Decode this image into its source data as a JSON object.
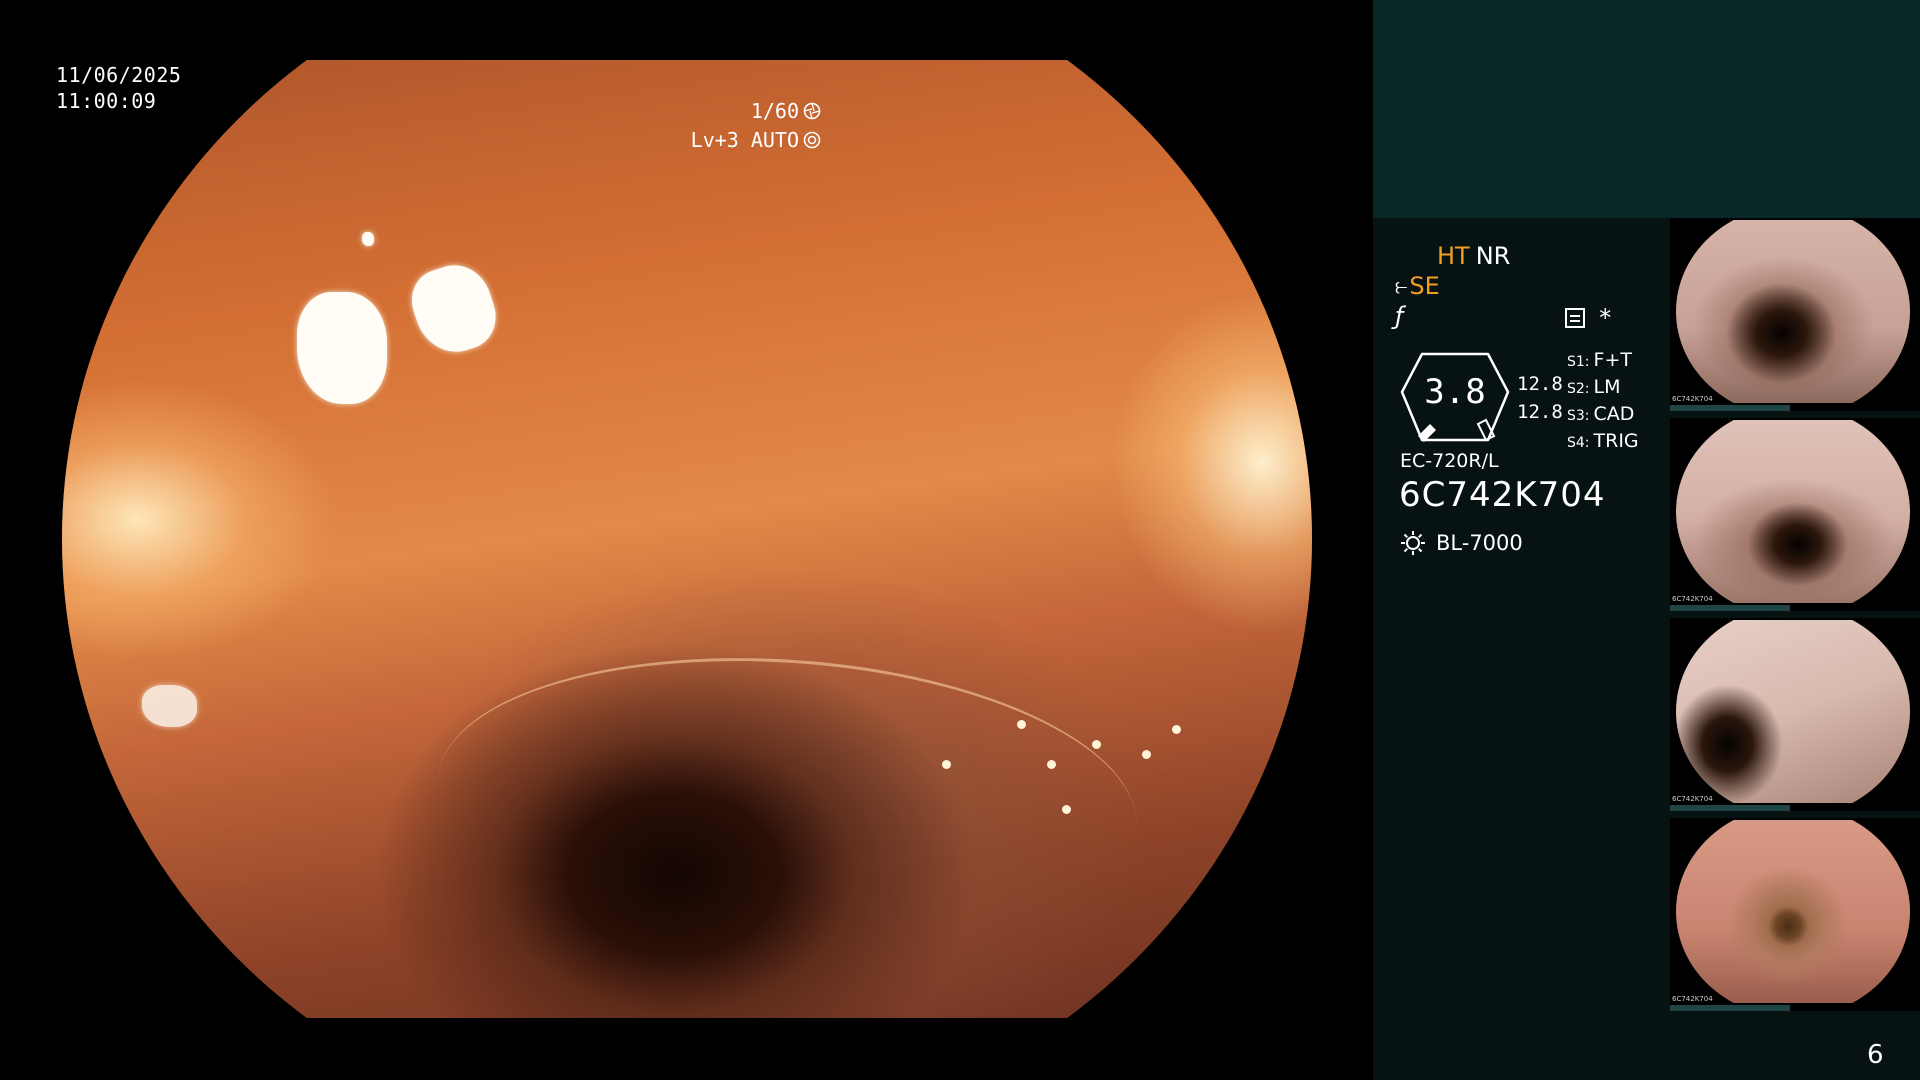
{
  "datetime": {
    "date": "11/06/2025",
    "time": "11:00:09"
  },
  "exposure": {
    "shutter": "1/60",
    "level": "Lv+3",
    "mode": "AUTO"
  },
  "status": {
    "ht": "HT",
    "nr": "NR",
    "se": "SE",
    "gauge_value": "3.8",
    "pressure_1": "12.8",
    "pressure_2": "12.8",
    "modes": [
      {
        "key": "S1:",
        "value": "F+T"
      },
      {
        "key": "S2:",
        "value": "LM"
      },
      {
        "key": "S3:",
        "value": "CAD"
      },
      {
        "key": "S4:",
        "value": "TRIG"
      }
    ],
    "scope_model": "EC-720R/L",
    "scope_serial": "6C742K704",
    "light_source": "BL-7000"
  },
  "thumbnails": [
    {
      "label": "6C742K704"
    },
    {
      "label": "6C742K704"
    },
    {
      "label": "6C742K704"
    },
    {
      "label": "6C742K704"
    }
  ],
  "page_number": "6",
  "icons": [
    "shutter-icon",
    "auto-exposure-icon",
    "scope-angle-icon",
    "freeze-icon",
    "menu-icon",
    "asterisk-icon",
    "light-source-icon"
  ]
}
